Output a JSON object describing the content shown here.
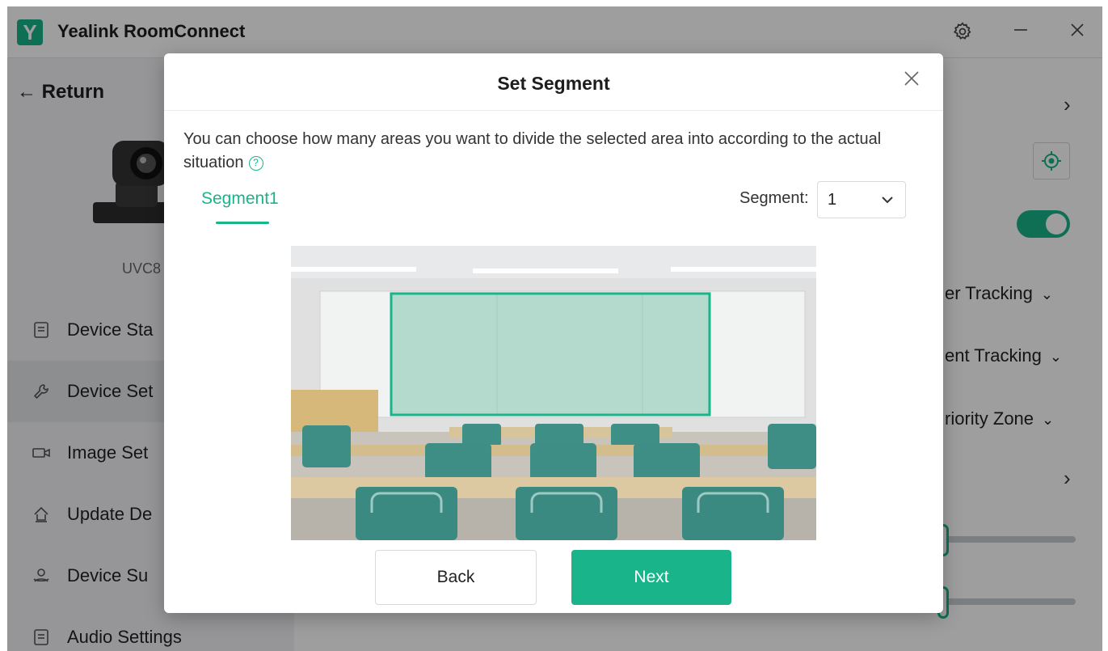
{
  "app": {
    "logo_letter": "Y",
    "title": "Yealink RoomConnect",
    "settings_icon": "gear-icon",
    "minimize_icon": "minimize-icon",
    "close_icon": "close-icon"
  },
  "sidebar": {
    "return_label": "Return",
    "device_model": "UVC8",
    "items": [
      {
        "label": "Device Sta",
        "icon": "document-icon"
      },
      {
        "label": "Device Set",
        "icon": "wrench-icon"
      },
      {
        "label": "Image Set",
        "icon": "video-camera-icon"
      },
      {
        "label": "Update De",
        "icon": "upload-icon"
      },
      {
        "label": "Device Su",
        "icon": "support-icon"
      },
      {
        "label": "Audio Settings",
        "icon": "document-icon"
      }
    ]
  },
  "main": {
    "options": [
      {
        "label": "er Tracking"
      },
      {
        "label": "ent Tracking"
      },
      {
        "label": "riority Zone"
      }
    ]
  },
  "modal": {
    "title": "Set Segment",
    "description": "You can choose how many areas you want to divide the selected area into according to the actual situation",
    "tab_label": "Segment1",
    "segment_label": "Segment:",
    "segment_value": "1",
    "back_label": "Back",
    "next_label": "Next"
  },
  "colors": {
    "accent": "#19b48a",
    "overlay": "rgba(0,0,0,0.38)"
  }
}
